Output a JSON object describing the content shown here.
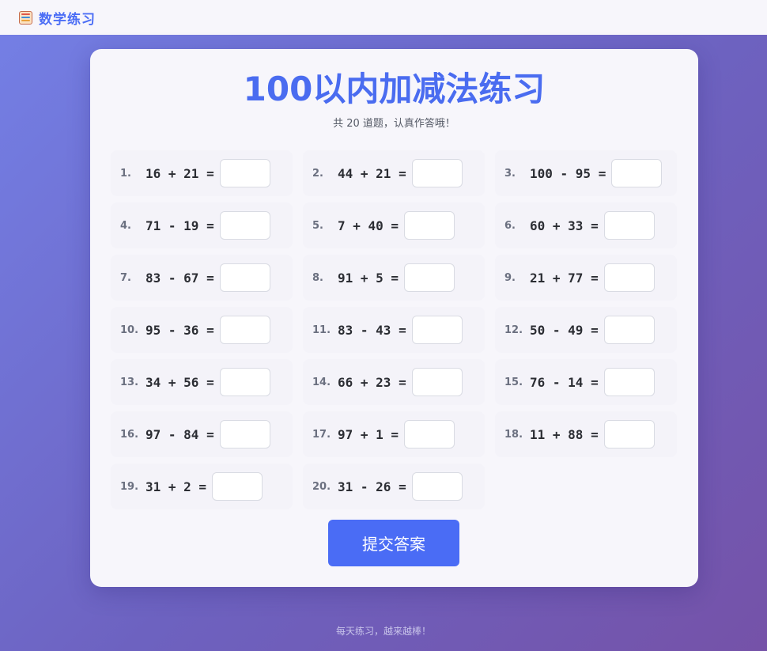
{
  "header": {
    "brand_name": "数学练习",
    "brand_icon": "abacus-icon"
  },
  "card": {
    "title": "100以内加减法练习",
    "subtitle": "共 20 道题，认真作答哦！",
    "problems": [
      {
        "number": "1.",
        "expression": "16 + 21 =",
        "answer": ""
      },
      {
        "number": "2.",
        "expression": "44 + 21 =",
        "answer": ""
      },
      {
        "number": "3.",
        "expression": "100 - 95 =",
        "answer": ""
      },
      {
        "number": "4.",
        "expression": "71 - 19 =",
        "answer": ""
      },
      {
        "number": "5.",
        "expression": "7 + 40 =",
        "answer": ""
      },
      {
        "number": "6.",
        "expression": "60 + 33 =",
        "answer": ""
      },
      {
        "number": "7.",
        "expression": "83 - 67 =",
        "answer": ""
      },
      {
        "number": "8.",
        "expression": "91 + 5 =",
        "answer": ""
      },
      {
        "number": "9.",
        "expression": "21 + 77 =",
        "answer": ""
      },
      {
        "number": "10.",
        "expression": "95 - 36 =",
        "answer": ""
      },
      {
        "number": "11.",
        "expression": "83 - 43 =",
        "answer": ""
      },
      {
        "number": "12.",
        "expression": "50 - 49 =",
        "answer": ""
      },
      {
        "number": "13.",
        "expression": "34 + 56 =",
        "answer": ""
      },
      {
        "number": "14.",
        "expression": "66 + 23 =",
        "answer": ""
      },
      {
        "number": "15.",
        "expression": "76 - 14 =",
        "answer": ""
      },
      {
        "number": "16.",
        "expression": "97 - 84 =",
        "answer": ""
      },
      {
        "number": "17.",
        "expression": "97 + 1 =",
        "answer": ""
      },
      {
        "number": "18.",
        "expression": "11 + 88 =",
        "answer": ""
      },
      {
        "number": "19.",
        "expression": "31 + 2 =",
        "answer": ""
      },
      {
        "number": "20.",
        "expression": "31 - 26 =",
        "answer": ""
      }
    ],
    "submit_label": "提交答案"
  },
  "footer": {
    "text": "每天练习，越来越棒！"
  },
  "colors": {
    "accent": "#4a6cf5",
    "background_start": "#7480e6",
    "background_end": "#7552a8"
  }
}
